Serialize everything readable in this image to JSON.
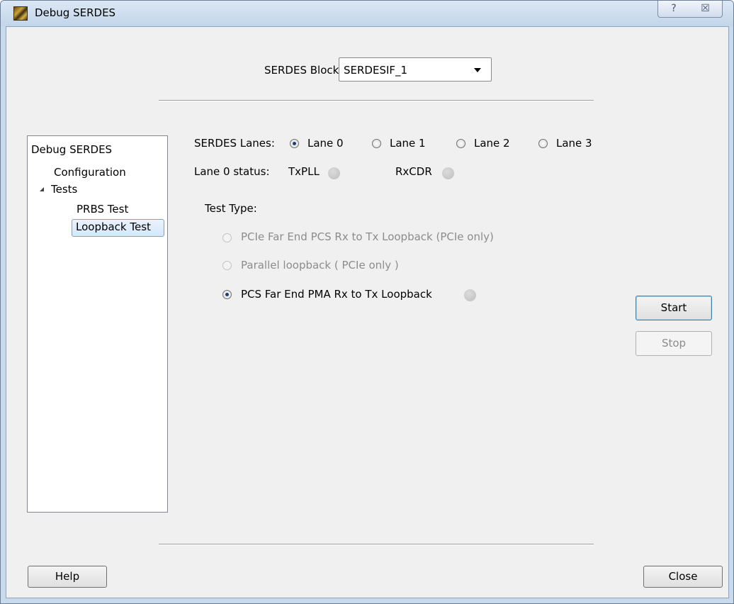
{
  "window": {
    "title": "Debug SERDES",
    "help_glyph": "?",
    "close_glyph": "☒",
    "icons": {
      "app": "microchip-app-icon",
      "help": "help-icon",
      "close": "close-icon"
    }
  },
  "serdes_block": {
    "label": "SERDES Block",
    "value": "SERDESIF_1"
  },
  "tree": {
    "root": "Debug SERDES",
    "items": [
      {
        "label": "Configuration"
      },
      {
        "label": "Tests",
        "expanded": true
      },
      {
        "label": "PRBS Test"
      },
      {
        "label": "Loopback Test",
        "selected": true
      }
    ]
  },
  "lanes": {
    "label": "SERDES Lanes:",
    "options": [
      "Lane 0",
      "Lane 1",
      "Lane 2",
      "Lane 3"
    ],
    "selected": "Lane 0"
  },
  "lane_status": {
    "label": "Lane 0 status:",
    "txpll": "TxPLL",
    "rxcdr": "RxCDR",
    "led_color": "#c8c8c8"
  },
  "test_type": {
    "label": "Test Type:",
    "options": [
      {
        "label": "PCIe Far End PCS Rx to Tx Loopback (PCIe only)",
        "enabled": false
      },
      {
        "label": "Parallel loopback ( PCIe only )",
        "enabled": false
      },
      {
        "label": "PCS Far End PMA Rx to Tx Loopback",
        "enabled": true,
        "selected": true
      }
    ]
  },
  "buttons": {
    "start": "Start",
    "stop": "Stop",
    "help": "Help",
    "close": "Close"
  },
  "colors": {
    "title_bar": "#c9daed",
    "client_bg": "#f0f0f0",
    "selection": "#d6e7fb"
  }
}
